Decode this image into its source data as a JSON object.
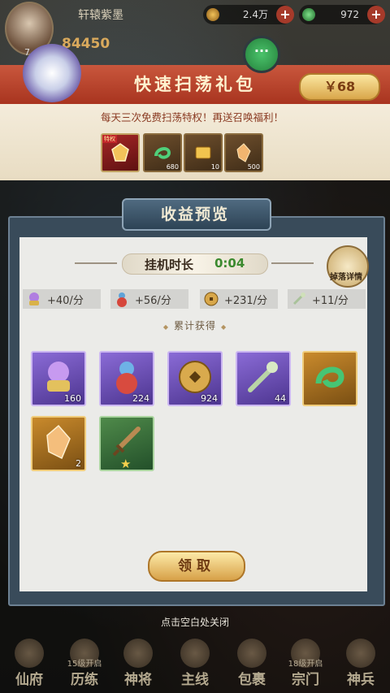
{
  "hud": {
    "player_name": "轩辕紫墨",
    "level": "7",
    "power": "84450",
    "res1_value": "2.4万",
    "res2_value": "972",
    "plus": "+"
  },
  "gift": {
    "title": "快速扫荡礼包",
    "desc": "每天三次免费扫荡特权！再送召唤福利！",
    "items": [
      {
        "tag": "特权",
        "count": ""
      },
      {
        "tag": "",
        "count": "680"
      },
      {
        "tag": "",
        "count": "10"
      },
      {
        "tag": "",
        "count": "500"
      }
    ],
    "price": "￥68"
  },
  "panel": {
    "title": "收益预览",
    "idle_label": "挂机时长",
    "idle_time": "0:04",
    "drop_details": "掉落详情",
    "rates": [
      "+40/分",
      "+56/分",
      "+231/分",
      "+11/分"
    ],
    "accum_label": "累计获得",
    "rewards": [
      {
        "color": "purple",
        "icon": "orb-pot-icon",
        "count": "160"
      },
      {
        "color": "purple",
        "icon": "gourd-icon",
        "count": "224"
      },
      {
        "color": "purple",
        "icon": "coin-icon",
        "count": "924"
      },
      {
        "color": "purple",
        "icon": "jade-ruyi-icon",
        "count": "44"
      },
      {
        "color": "gold",
        "icon": "jade-dragon-icon",
        "count": ""
      },
      {
        "color": "gold",
        "icon": "crystal-icon",
        "count": "2"
      },
      {
        "color": "green",
        "icon": "sword-icon",
        "count": ""
      }
    ],
    "claim": "领取"
  },
  "close_hint": "点击空白处关闭",
  "nav": [
    {
      "label": "仙府",
      "lock": ""
    },
    {
      "label": "历练",
      "lock": "15级开启"
    },
    {
      "label": "神将",
      "lock": ""
    },
    {
      "label": "主线",
      "lock": ""
    },
    {
      "label": "包裹",
      "lock": ""
    },
    {
      "label": "宗门",
      "lock": "18级开启"
    },
    {
      "label": "神兵",
      "lock": ""
    }
  ],
  "colors": {
    "banner_red": "#a8341f",
    "panel_blue": "#394b5a",
    "gold_button": "#d9a64a",
    "idle_green": "#3b8a2f"
  }
}
